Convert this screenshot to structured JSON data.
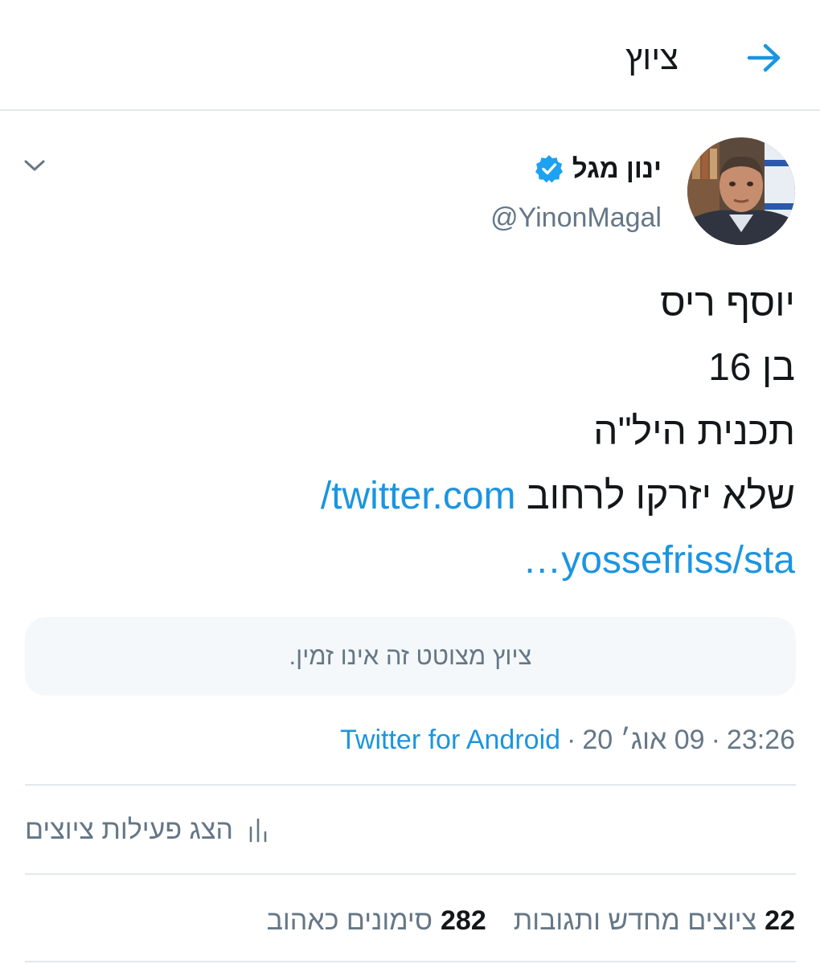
{
  "header": {
    "title": "ציוץ"
  },
  "tweet": {
    "author_name": "ינון מגל",
    "author_handle": "@YinonMagal",
    "text_lines": [
      "יוסף ריס",
      "בן 16",
      "תכנית היל\"ה",
      "שלא יזרקו לרחוב"
    ],
    "link_line1": "twitter.com/",
    "link_line2": "yossefriss/sta…",
    "quote_notice": "ציוץ מצוטט זה אינו זמין.",
    "time": "23:26",
    "date": "09 אוג׳ 20",
    "separator": "·",
    "source": "Twitter for Android",
    "activity_label": "הצג פעילות ציוצים",
    "retweets_count": "22",
    "retweets_label": "ציוצים מחדש ותגובות",
    "likes_count": "282",
    "likes_label": "סימונים כאהוב"
  },
  "colors": {
    "accent": "#1b95e0",
    "secondary_text": "#657786",
    "divider": "#e1e8ed",
    "quote_background": "#f5f8fa",
    "verified": "#1da1f2"
  },
  "icons": {
    "back": "arrow-right-icon",
    "verified": "verified-badge-icon",
    "menu": "chevron-down-icon",
    "activity": "bar-chart-icon"
  }
}
